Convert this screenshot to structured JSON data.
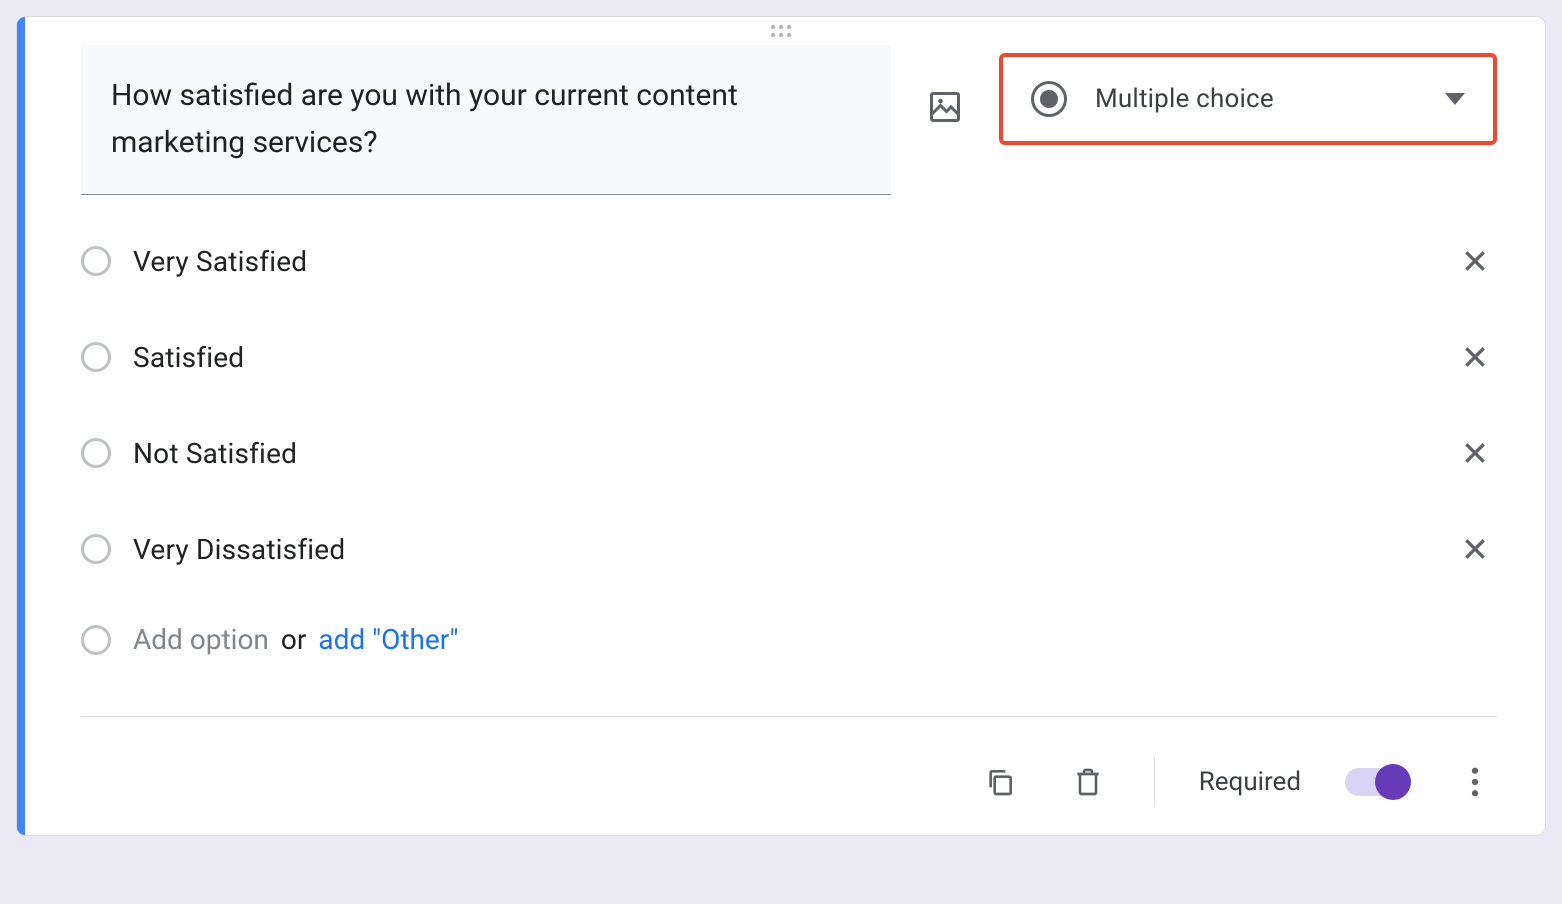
{
  "question": {
    "text": "How satisfied are you with your current content marketing services?",
    "type_label": "Multiple choice"
  },
  "options": [
    {
      "label": "Very Satisfied"
    },
    {
      "label": "Satisfied"
    },
    {
      "label": "Not Satisfied"
    },
    {
      "label": "Very Dissatisfied"
    }
  ],
  "add_row": {
    "add_option": "Add option",
    "or": "or",
    "add_other": "add \"Other\""
  },
  "footer": {
    "required_label": "Required",
    "required_on": true
  },
  "highlight": {
    "type_selector_color": "#e84a33"
  }
}
